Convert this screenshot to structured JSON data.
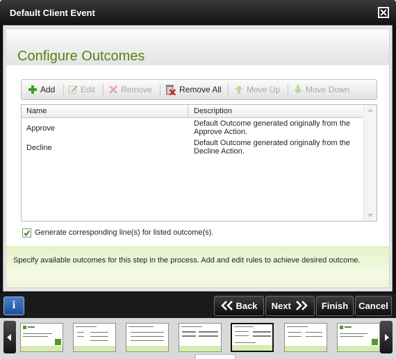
{
  "window": {
    "title": "Default Client Event"
  },
  "page": {
    "title": "Configure Outcomes"
  },
  "toolbar": {
    "add_label": "Add",
    "edit_label": "Edit",
    "remove_label": "Remove",
    "remove_all_label": "Remove All",
    "move_up_label": "Move Up",
    "move_down_label": "Move Down"
  },
  "grid": {
    "columns": [
      "Name",
      "Description"
    ],
    "rows": [
      {
        "name": "Approve",
        "description": "Default Outcome generated originally from the Approve Action."
      },
      {
        "name": "Decline",
        "description": "Default Outcome generated originally from the Decline Action."
      }
    ]
  },
  "generate_lines": {
    "checked": true,
    "label": "Generate corresponding line(s) for listed outcome(s)."
  },
  "hint": {
    "text": "Specify available outcomes for this step in the process.  Add and edit rules to achieve desired outcome."
  },
  "nav": {
    "back_label": "Back",
    "next_label": "Next",
    "finish_label": "Finish",
    "cancel_label": "Cancel",
    "info_label": "i"
  },
  "thumbnails": {
    "count": 7,
    "active_index": 4
  },
  "colors": {
    "title_green": "#5c7f13",
    "info_blue": "#2a5fae",
    "hint_band": "#e6f3c8"
  }
}
